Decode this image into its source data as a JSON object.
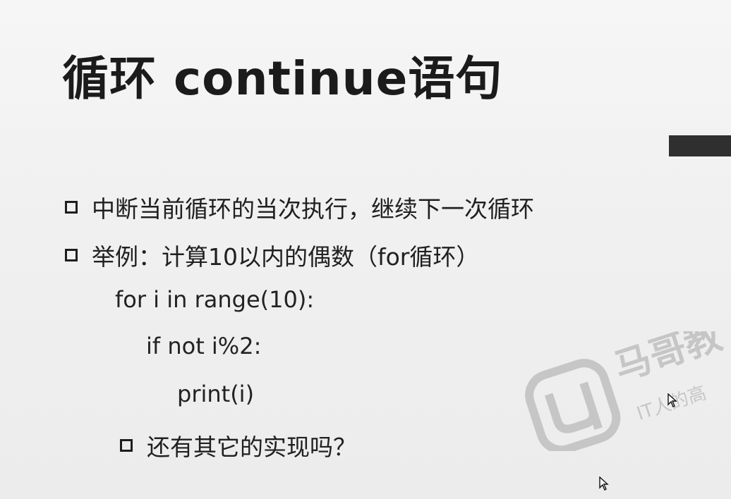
{
  "slide": {
    "title": "循环 continue语句",
    "bullets": [
      "中断当前循环的当次执行，继续下一次循环",
      "举例：计算10以内的偶数（for循环）"
    ],
    "code_lines": [
      "for i in range(10):",
      "if not i%2:",
      "print(i)"
    ],
    "sub_bullet": "还有其它的实现吗？",
    "watermark": {
      "brand_text": "马哥教",
      "tagline": "IT人的高"
    }
  },
  "colors": {
    "background": "#f2f2f2",
    "text": "#1a1a1a",
    "accent_bar": "#2f2f2f"
  },
  "icons": [
    "checkbox-bullet-icon",
    "mouse-pointer-icon",
    "brand-logo-icon"
  ]
}
